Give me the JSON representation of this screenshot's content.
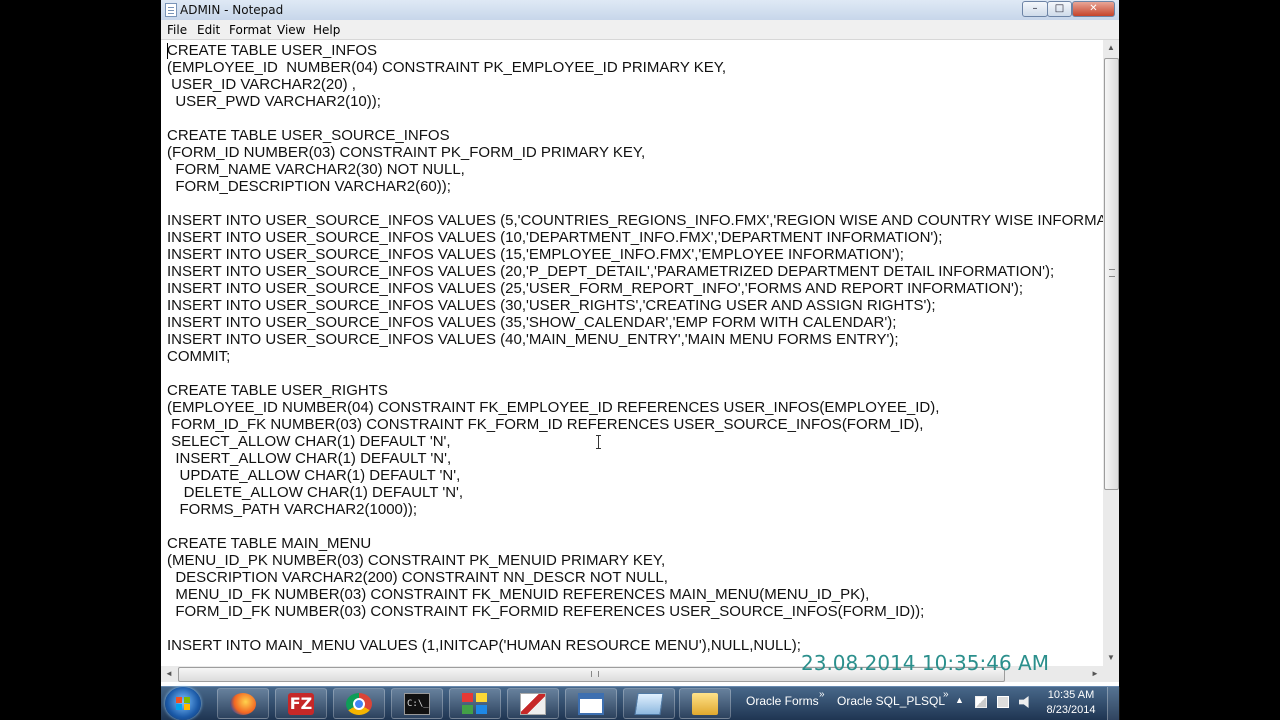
{
  "window": {
    "title": "ADMIN - Notepad"
  },
  "titlebar_buttons": {
    "minimize": "–",
    "maximize": "□",
    "close": "✕"
  },
  "menu": {
    "file": "File",
    "edit": "Edit",
    "format": "Format",
    "view": "View",
    "help": "Help"
  },
  "editor": {
    "content": "CREATE TABLE USER_INFOS\n(EMPLOYEE_ID  NUMBER(04) CONSTRAINT PK_EMPLOYEE_ID PRIMARY KEY,\n USER_ID VARCHAR2(20) ,\n  USER_PWD VARCHAR2(10));\n\nCREATE TABLE USER_SOURCE_INFOS\n(FORM_ID NUMBER(03) CONSTRAINT PK_FORM_ID PRIMARY KEY,\n  FORM_NAME VARCHAR2(30) NOT NULL,\n  FORM_DESCRIPTION VARCHAR2(60));\n\nINSERT INTO USER_SOURCE_INFOS VALUES (5,'COUNTRIES_REGIONS_INFO.FMX','REGION WISE AND COUNTRY WISE INFORMATION');\nINSERT INTO USER_SOURCE_INFOS VALUES (10,'DEPARTMENT_INFO.FMX','DEPARTMENT INFORMATION');\nINSERT INTO USER_SOURCE_INFOS VALUES (15,'EMPLOYEE_INFO.FMX','EMPLOYEE INFORMATION');\nINSERT INTO USER_SOURCE_INFOS VALUES (20,'P_DEPT_DETAIL','PARAMETRIZED DEPARTMENT DETAIL INFORMATION');\nINSERT INTO USER_SOURCE_INFOS VALUES (25,'USER_FORM_REPORT_INFO','FORMS AND REPORT INFORMATION');\nINSERT INTO USER_SOURCE_INFOS VALUES (30,'USER_RIGHTS','CREATING USER AND ASSIGN RIGHTS');\nINSERT INTO USER_SOURCE_INFOS VALUES (35,'SHOW_CALENDAR','EMP FORM WITH CALENDAR');\nINSERT INTO USER_SOURCE_INFOS VALUES (40,'MAIN_MENU_ENTRY','MAIN MENU FORMS ENTRY');\nCOMMIT;\n\nCREATE TABLE USER_RIGHTS\n(EMPLOYEE_ID NUMBER(04) CONSTRAINT FK_EMPLOYEE_ID REFERENCES USER_INFOS(EMPLOYEE_ID),\n FORM_ID_FK NUMBER(03) CONSTRAINT FK_FORM_ID REFERENCES USER_SOURCE_INFOS(FORM_ID),\n SELECT_ALLOW CHAR(1) DEFAULT 'N',\n  INSERT_ALLOW CHAR(1) DEFAULT 'N',\n   UPDATE_ALLOW CHAR(1) DEFAULT 'N',\n    DELETE_ALLOW CHAR(1) DEFAULT 'N',\n   FORMS_PATH VARCHAR2(1000));\n\nCREATE TABLE MAIN_MENU\n(MENU_ID_PK NUMBER(03) CONSTRAINT PK_MENUID PRIMARY KEY,\n  DESCRIPTION VARCHAR2(200) CONSTRAINT NN_DESCR NOT NULL,\n  MENU_ID_FK NUMBER(03) CONSTRAINT FK_MENUID REFERENCES MAIN_MENU(MENU_ID_PK),\n  FORM_ID_FK NUMBER(03) CONSTRAINT FK_FORMID REFERENCES USER_SOURCE_INFOS(FORM_ID));\n\nINSERT INTO MAIN_MENU VALUES (1,INITCAP('HUMAN RESOURCE MENU'),NULL,NULL);"
  },
  "scrollbars": {
    "up": "▲",
    "down": "▼",
    "left": "◄",
    "right": "►"
  },
  "overlay": {
    "datestamp": "23.08.2014 10:35:46 AM"
  },
  "taskbar": {
    "filezilla_glyph": "FZ",
    "cmd_glyph": "C:\\_",
    "oracle_forms": "Oracle Forms",
    "oracle_sql": "Oracle SQL_PLSQL",
    "chevron": "»",
    "tray_up": "▲",
    "clock_time": "10:35 AM",
    "clock_date": "8/23/2014"
  },
  "icons": [
    "start-orb-icon",
    "firefox-icon",
    "filezilla-icon",
    "chrome-icon",
    "cmd-icon",
    "apps-icon",
    "oracle-forms-icon",
    "window-icon",
    "notepad-icon",
    "folder-icon"
  ],
  "colors": {
    "datestamp": "#2b8f8c",
    "taskbar": "#2c4766",
    "close_button": "#c5432b"
  }
}
